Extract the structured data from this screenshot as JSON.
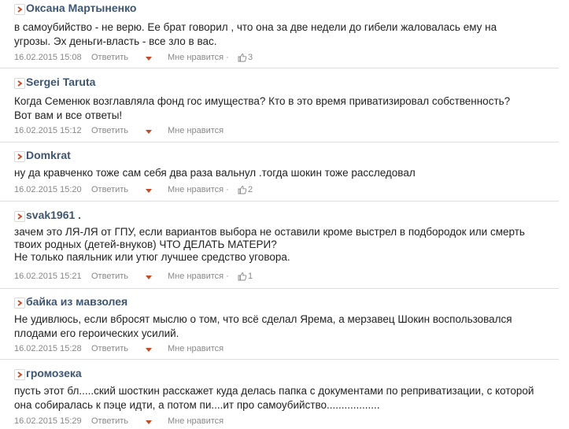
{
  "comments": [
    {
      "author": "Оксана Мартыненко",
      "lines": [
        "в самоубийство - не верю. Ее брат говорил , что она за две недели до гибели жаловалась ему на",
        "угрозы. Эх деньги-власть - все зло в вас."
      ],
      "date": "16.02.2015 15:08",
      "reply": "Ответить",
      "like": "Мне нравится ·",
      "likes": "3"
    },
    {
      "author": "Sergei Taruta",
      "lines": [
        "Когда Семенюк возглавляла фонд гос имущества? Кто в это время приватизировал собственность?",
        "Вот вам и все ответы!"
      ],
      "date": "16.02.2015 15:12",
      "reply": "Ответить",
      "like": "Мне нравится",
      "likes": ""
    },
    {
      "author": "Domkrat",
      "lines": [
        "ну да кравченко тоже сам себя два раза вальнул .тогда шокин тоже расследовал"
      ],
      "date": "16.02.2015 15:20",
      "reply": "Ответить",
      "like": "Мне нравится ·",
      "likes": "2"
    },
    {
      "author": "svak1961 .",
      "lines": [
        "зачем это ЛЯ-ЛЯ от ГПУ, если вариантов выбора не оставили кроме выстрел в подбородок или смерть",
        "твоих родных (детей-внуков) ЧТО ДЕЛАТЬ МАТЕРИ?",
        "Не только паяльник или утюг лучшее средство уговора."
      ],
      "date": "16.02.2015 15:21",
      "reply": "Ответить",
      "like": "Мне нравится ·",
      "likes": "1"
    },
    {
      "author": "байка из мавзолея",
      "lines": [
        "Не удивлюсь, если вбросят мыслю о том, что всё сделал Ярема, а мерзавец Шокин воспользовался",
        "плодами его героических усилий."
      ],
      "date": "16.02.2015 15:28",
      "reply": "Ответить",
      "like": "Мне нравится",
      "likes": ""
    },
    {
      "author": "громозека",
      "lines": [
        "пусть этот бл.....ский шосткин расскажет куда делась папка с документами по реприватизации, с которой",
        "она собиралась к пэце идти, а потом пи....ит про самоубийство.................."
      ],
      "date": "16.02.2015 15:29",
      "reply": "Ответить",
      "like": "Мне нравится",
      "likes": ""
    }
  ],
  "icons": {
    "chevron": "chevron-right-icon",
    "reply_menu": "caret-down-icon",
    "like": "thumbs-up-icon"
  },
  "colors": {
    "author": "#3e5671",
    "accent": "#c64a26",
    "meta": "#888888",
    "text": "#222222",
    "separator": "#dedede"
  }
}
